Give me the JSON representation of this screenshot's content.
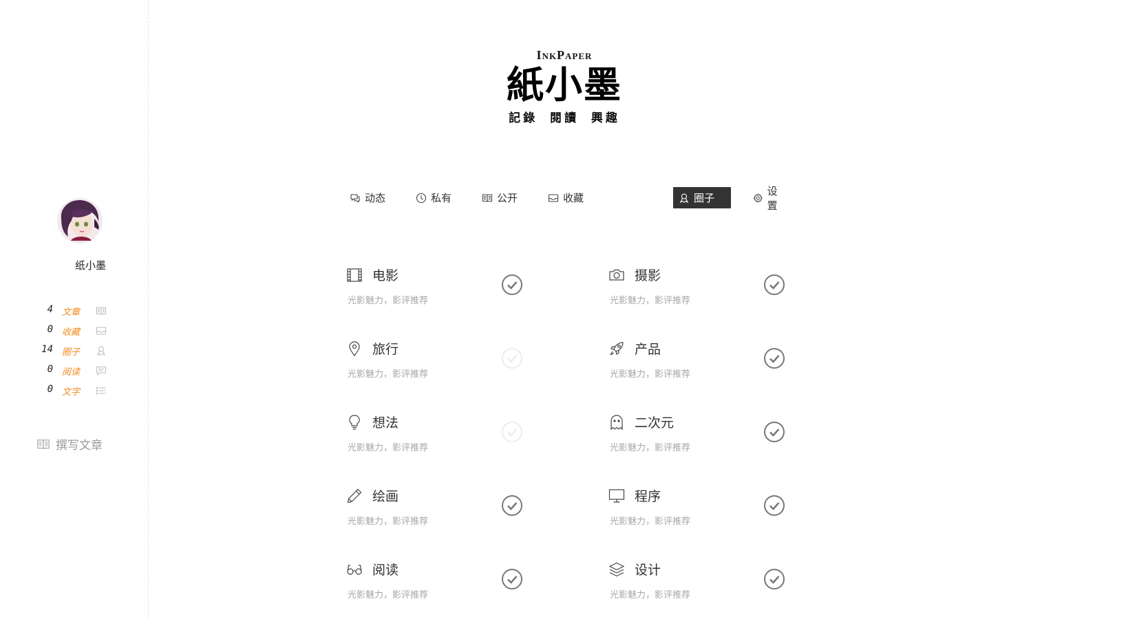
{
  "logo": {
    "en": "InkPaper",
    "cn": "紙小墨",
    "sub": "記錄 閱讀 興趣"
  },
  "user": {
    "name": "纸小墨"
  },
  "stats": [
    {
      "count": "4",
      "label": "文章",
      "icon": "book-icon"
    },
    {
      "count": "0",
      "label": "收藏",
      "icon": "inbox-icon"
    },
    {
      "count": "14",
      "label": "圈子",
      "icon": "group-icon"
    },
    {
      "count": "0",
      "label": "阅读",
      "icon": "comment-icon"
    },
    {
      "count": "0",
      "label": "文字",
      "icon": "list-icon"
    }
  ],
  "write_link": {
    "label": "撰写文章",
    "icon": "book-icon"
  },
  "nav": [
    {
      "label": "动态",
      "icon": "chat-icon",
      "active": false
    },
    {
      "label": "私有",
      "icon": "clock-icon",
      "active": false
    },
    {
      "label": "公开",
      "icon": "book-icon",
      "active": false
    },
    {
      "label": "收藏",
      "icon": "inbox-icon",
      "active": false
    },
    {
      "label": "圈子",
      "icon": "group-icon",
      "active": true
    },
    {
      "label": "设置",
      "icon": "gear-icon",
      "active": false
    }
  ],
  "categories": [
    {
      "title": "电影",
      "desc": "光影魅力，影评推荐",
      "icon": "film-icon",
      "checked": true
    },
    {
      "title": "摄影",
      "desc": "光影魅力，影评推荐",
      "icon": "camera-icon",
      "checked": true
    },
    {
      "title": "旅行",
      "desc": "光影魅力，影评推荐",
      "icon": "location-pin-icon",
      "checked": false
    },
    {
      "title": "产品",
      "desc": "光影魅力，影评推荐",
      "icon": "rocket-icon",
      "checked": true
    },
    {
      "title": "想法",
      "desc": "光影魅力，影评推荐",
      "icon": "lightbulb-icon",
      "checked": false
    },
    {
      "title": "二次元",
      "desc": "光影魅力，影评推荐",
      "icon": "ghost-icon",
      "checked": true
    },
    {
      "title": "绘画",
      "desc": "光影魅力，影评推荐",
      "icon": "pencil-icon",
      "checked": true
    },
    {
      "title": "程序",
      "desc": "光影魅力，影评推荐",
      "icon": "monitor-icon",
      "checked": true
    },
    {
      "title": "阅读",
      "desc": "光影魅力，影评推荐",
      "icon": "glasses-icon",
      "checked": true
    },
    {
      "title": "设计",
      "desc": "光影魅力，影评推荐",
      "icon": "layers-icon",
      "checked": true
    }
  ],
  "colors": {
    "accent": "#f08c1e",
    "active_nav": "#333333",
    "muted": "#a7a7a7"
  }
}
